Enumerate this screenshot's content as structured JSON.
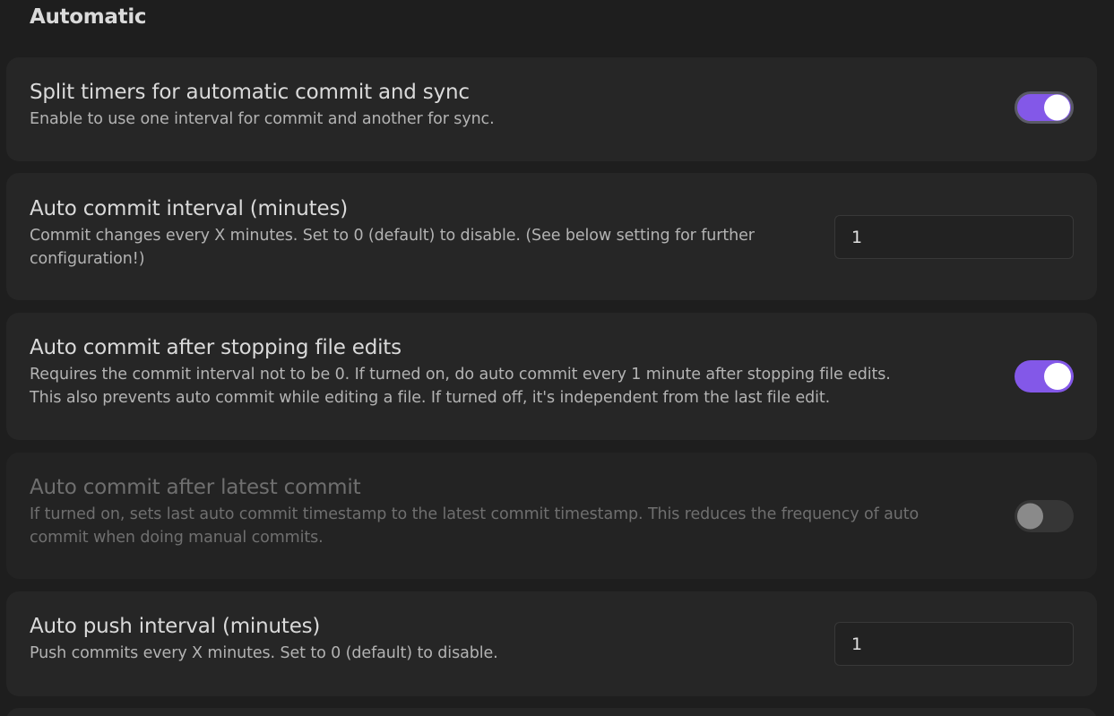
{
  "section": {
    "heading": "Automatic"
  },
  "settings": [
    {
      "title": "Split timers for automatic commit and sync",
      "description": "Enable to use one interval for commit and another for sync.",
      "control": "toggle",
      "state": "on"
    },
    {
      "title": "Auto commit interval (minutes)",
      "description_lines": [
        "Commit changes every X minutes. Set to 0 (default) to disable. (See below setting for further",
        "configuration!)"
      ],
      "control": "input",
      "value": "1"
    },
    {
      "title": "Auto commit after stopping file edits",
      "description_lines": [
        "Requires the commit interval not to be 0. If turned on, do auto commit every 1 minute after stopping file edits.",
        "This also prevents auto commit while editing a file. If turned off, it's independent from the last file edit."
      ],
      "control": "toggle",
      "state": "on"
    },
    {
      "title": "Auto commit after latest commit",
      "description_lines": [
        "If turned on, sets last auto commit timestamp to the latest commit timestamp. This reduces the frequency of auto",
        "commit when doing manual commits."
      ],
      "control": "toggle",
      "state": "off",
      "disabled": true
    },
    {
      "title": "Auto push interval (minutes)",
      "description": "Push commits every X minutes. Set to 0 (default) to disable.",
      "control": "input",
      "value": "1"
    }
  ],
  "colors": {
    "background": "#1e1e1e",
    "card": "#262626",
    "accent": "#8358e8",
    "toggle_off": "#363636"
  }
}
